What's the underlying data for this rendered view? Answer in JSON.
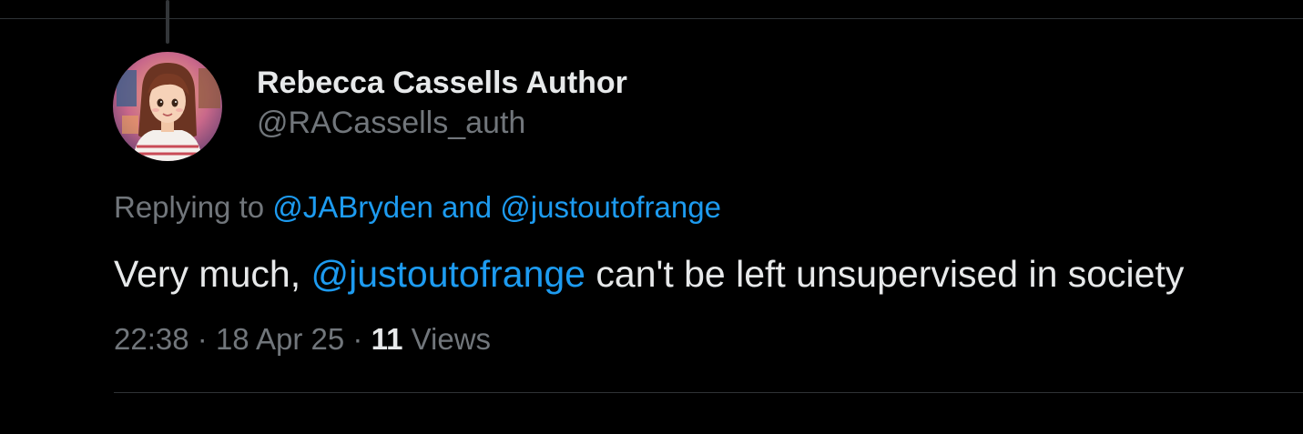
{
  "tweet": {
    "author": {
      "display_name": "Rebecca Cassells Author",
      "handle": "@RACassells_auth",
      "avatar_icon": "profile-avatar-illustration"
    },
    "replying": {
      "prefix": "Replying to",
      "first_mention": "@JABryden",
      "conjunction": "and",
      "second_mention": "@justoutofrange"
    },
    "text": {
      "before": "Very much,",
      "mention": "@justoutofrange",
      "after": "can't be left unsupervised in society"
    },
    "meta": {
      "time": "22:38",
      "separator_1": "·",
      "date": "18 Apr 25",
      "separator_2": "·",
      "views_count": "11",
      "views_label": "Views"
    }
  },
  "colors": {
    "background": "#000000",
    "primary_text": "#e7e9ea",
    "secondary_text": "#71767b",
    "link": "#1d9bf0",
    "divider": "#2f3336"
  }
}
